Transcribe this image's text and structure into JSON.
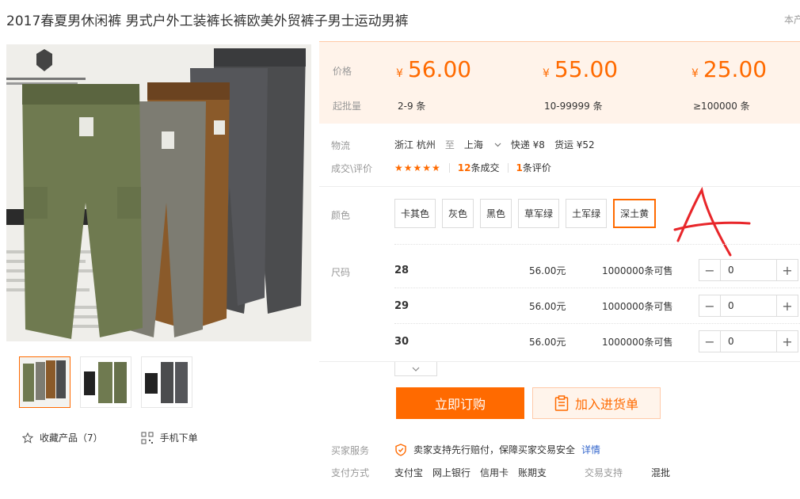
{
  "title": "2017春夏男休闲裤 男式户外工装裤长裤欧美外贸裤子男士运动男裤",
  "title_right": "本产",
  "left": {
    "favorite_label": "收藏产品（7）",
    "mobile_label": "手机下单",
    "thumbnails": [
      {
        "active": true
      },
      {
        "active": false
      },
      {
        "active": false
      }
    ]
  },
  "pricing": {
    "price_label": "价格",
    "moq_label": "起批量",
    "currency": "¥",
    "tiers": [
      {
        "price": "56.00",
        "range": "2-9 条"
      },
      {
        "price": "55.00",
        "range": "10-99999 条"
      },
      {
        "price": "25.00",
        "range": "≥100000 条"
      }
    ]
  },
  "logistics": {
    "label": "物流",
    "from": "浙江 杭州",
    "to_word": "至",
    "dest": "上海",
    "express": "快递 ¥8",
    "freight": "货运 ¥52"
  },
  "deals": {
    "label": "成交\\评价",
    "stars": "★★★★★",
    "deal_count": "12",
    "deal_suffix": "条成交",
    "review_count": "1",
    "review_suffix": "条评价"
  },
  "color": {
    "label": "颜色",
    "options": [
      "卡其色",
      "灰色",
      "黑色",
      "草军绿",
      "土军绿",
      "深土黄"
    ],
    "selected": "深土黄"
  },
  "size": {
    "label": "尺码",
    "rows": [
      {
        "name": "28",
        "price": "56.00元",
        "stock": "1000000条可售",
        "qty": "0"
      },
      {
        "name": "29",
        "price": "56.00元",
        "stock": "1000000条可售",
        "qty": "0"
      },
      {
        "name": "30",
        "price": "56.00元",
        "stock": "1000000条可售",
        "qty": "0"
      }
    ]
  },
  "actions": {
    "buy": "立即订购",
    "cart": "加入进货单"
  },
  "service": {
    "label": "买家服务",
    "text": "卖家支持先行赔付，保障买家交易安全",
    "link": "详情"
  },
  "payment": {
    "label": "支付方式",
    "methods": [
      "支付宝",
      "网上银行",
      "信用卡",
      "账期支"
    ],
    "trade_label": "交易支持",
    "trade_value": "混批"
  },
  "colors": {
    "accent": "#ff6a00",
    "price_bg": "#fff3ea",
    "link": "#3366cc",
    "annotation": "#e8262a"
  }
}
